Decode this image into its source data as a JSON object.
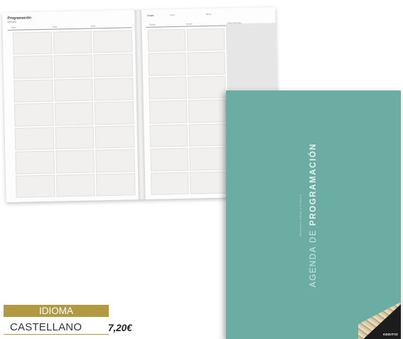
{
  "planner": {
    "left_title": "Programación",
    "left_subtitle": "semana",
    "left_columns": [
      "Área",
      "Área",
      "Área"
    ],
    "right_fields": [
      "Grupo",
      "Área",
      "Tema"
    ],
    "right_columns": [
      "Sesión",
      "Sesión",
      "Observaciones"
    ]
  },
  "cover": {
    "title_light": "AGENDA DE ",
    "title_bold": "PROGRAMACIÓN",
    "subtitle": "Educación Infantil y Primaria",
    "brand": "ADDITIO",
    "color": "#6cada3"
  },
  "product": {
    "idioma_label": "IDIOMA",
    "idioma_value": "CASTELLANO",
    "price": "7,20€",
    "accent": "#b29a43"
  }
}
